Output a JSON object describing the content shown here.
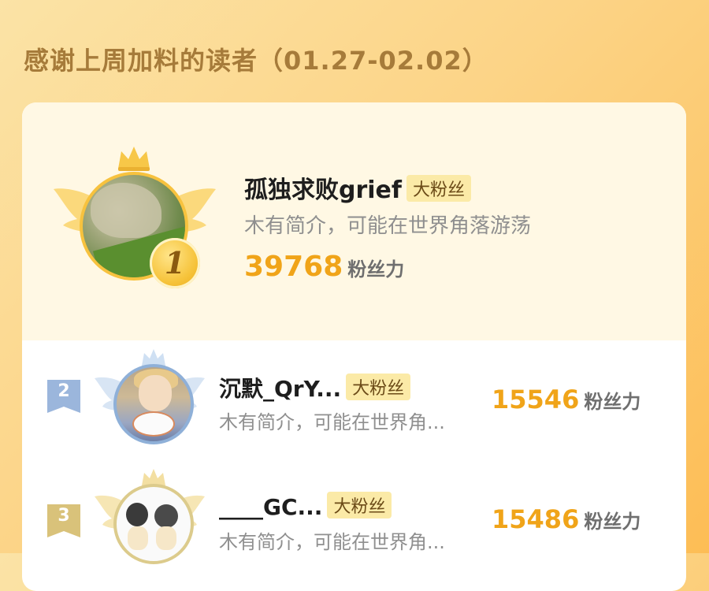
{
  "header": {
    "title": "感谢上周加料的读者（01.27-02.02）"
  },
  "colors": {
    "accent": "#f0a419",
    "badge_bg": "#fbeaa7",
    "title_color": "#a67b3a"
  },
  "ranking": {
    "first": {
      "rank": "1",
      "name": "孤独求败grief",
      "badge": "大粉丝",
      "bio": "木有简介，可能在世界角落游荡",
      "fans": "39768",
      "fans_label": "粉丝力",
      "icons": [
        "crown-icon",
        "wings-icon",
        "gold-medal-icon"
      ]
    },
    "rows": [
      {
        "rank": "2",
        "name": "沉默_QrY...",
        "badge": "大粉丝",
        "bio": "木有简介，可能在世界角...",
        "fans": "15546",
        "fans_label": "粉丝力",
        "rank_color": "#9bb6dc"
      },
      {
        "rank": "3",
        "name": "____GC...",
        "badge": "大粉丝",
        "bio": "木有简介，可能在世界角...",
        "fans": "15486",
        "fans_label": "粉丝力",
        "rank_color": "#d9c27a"
      }
    ]
  }
}
